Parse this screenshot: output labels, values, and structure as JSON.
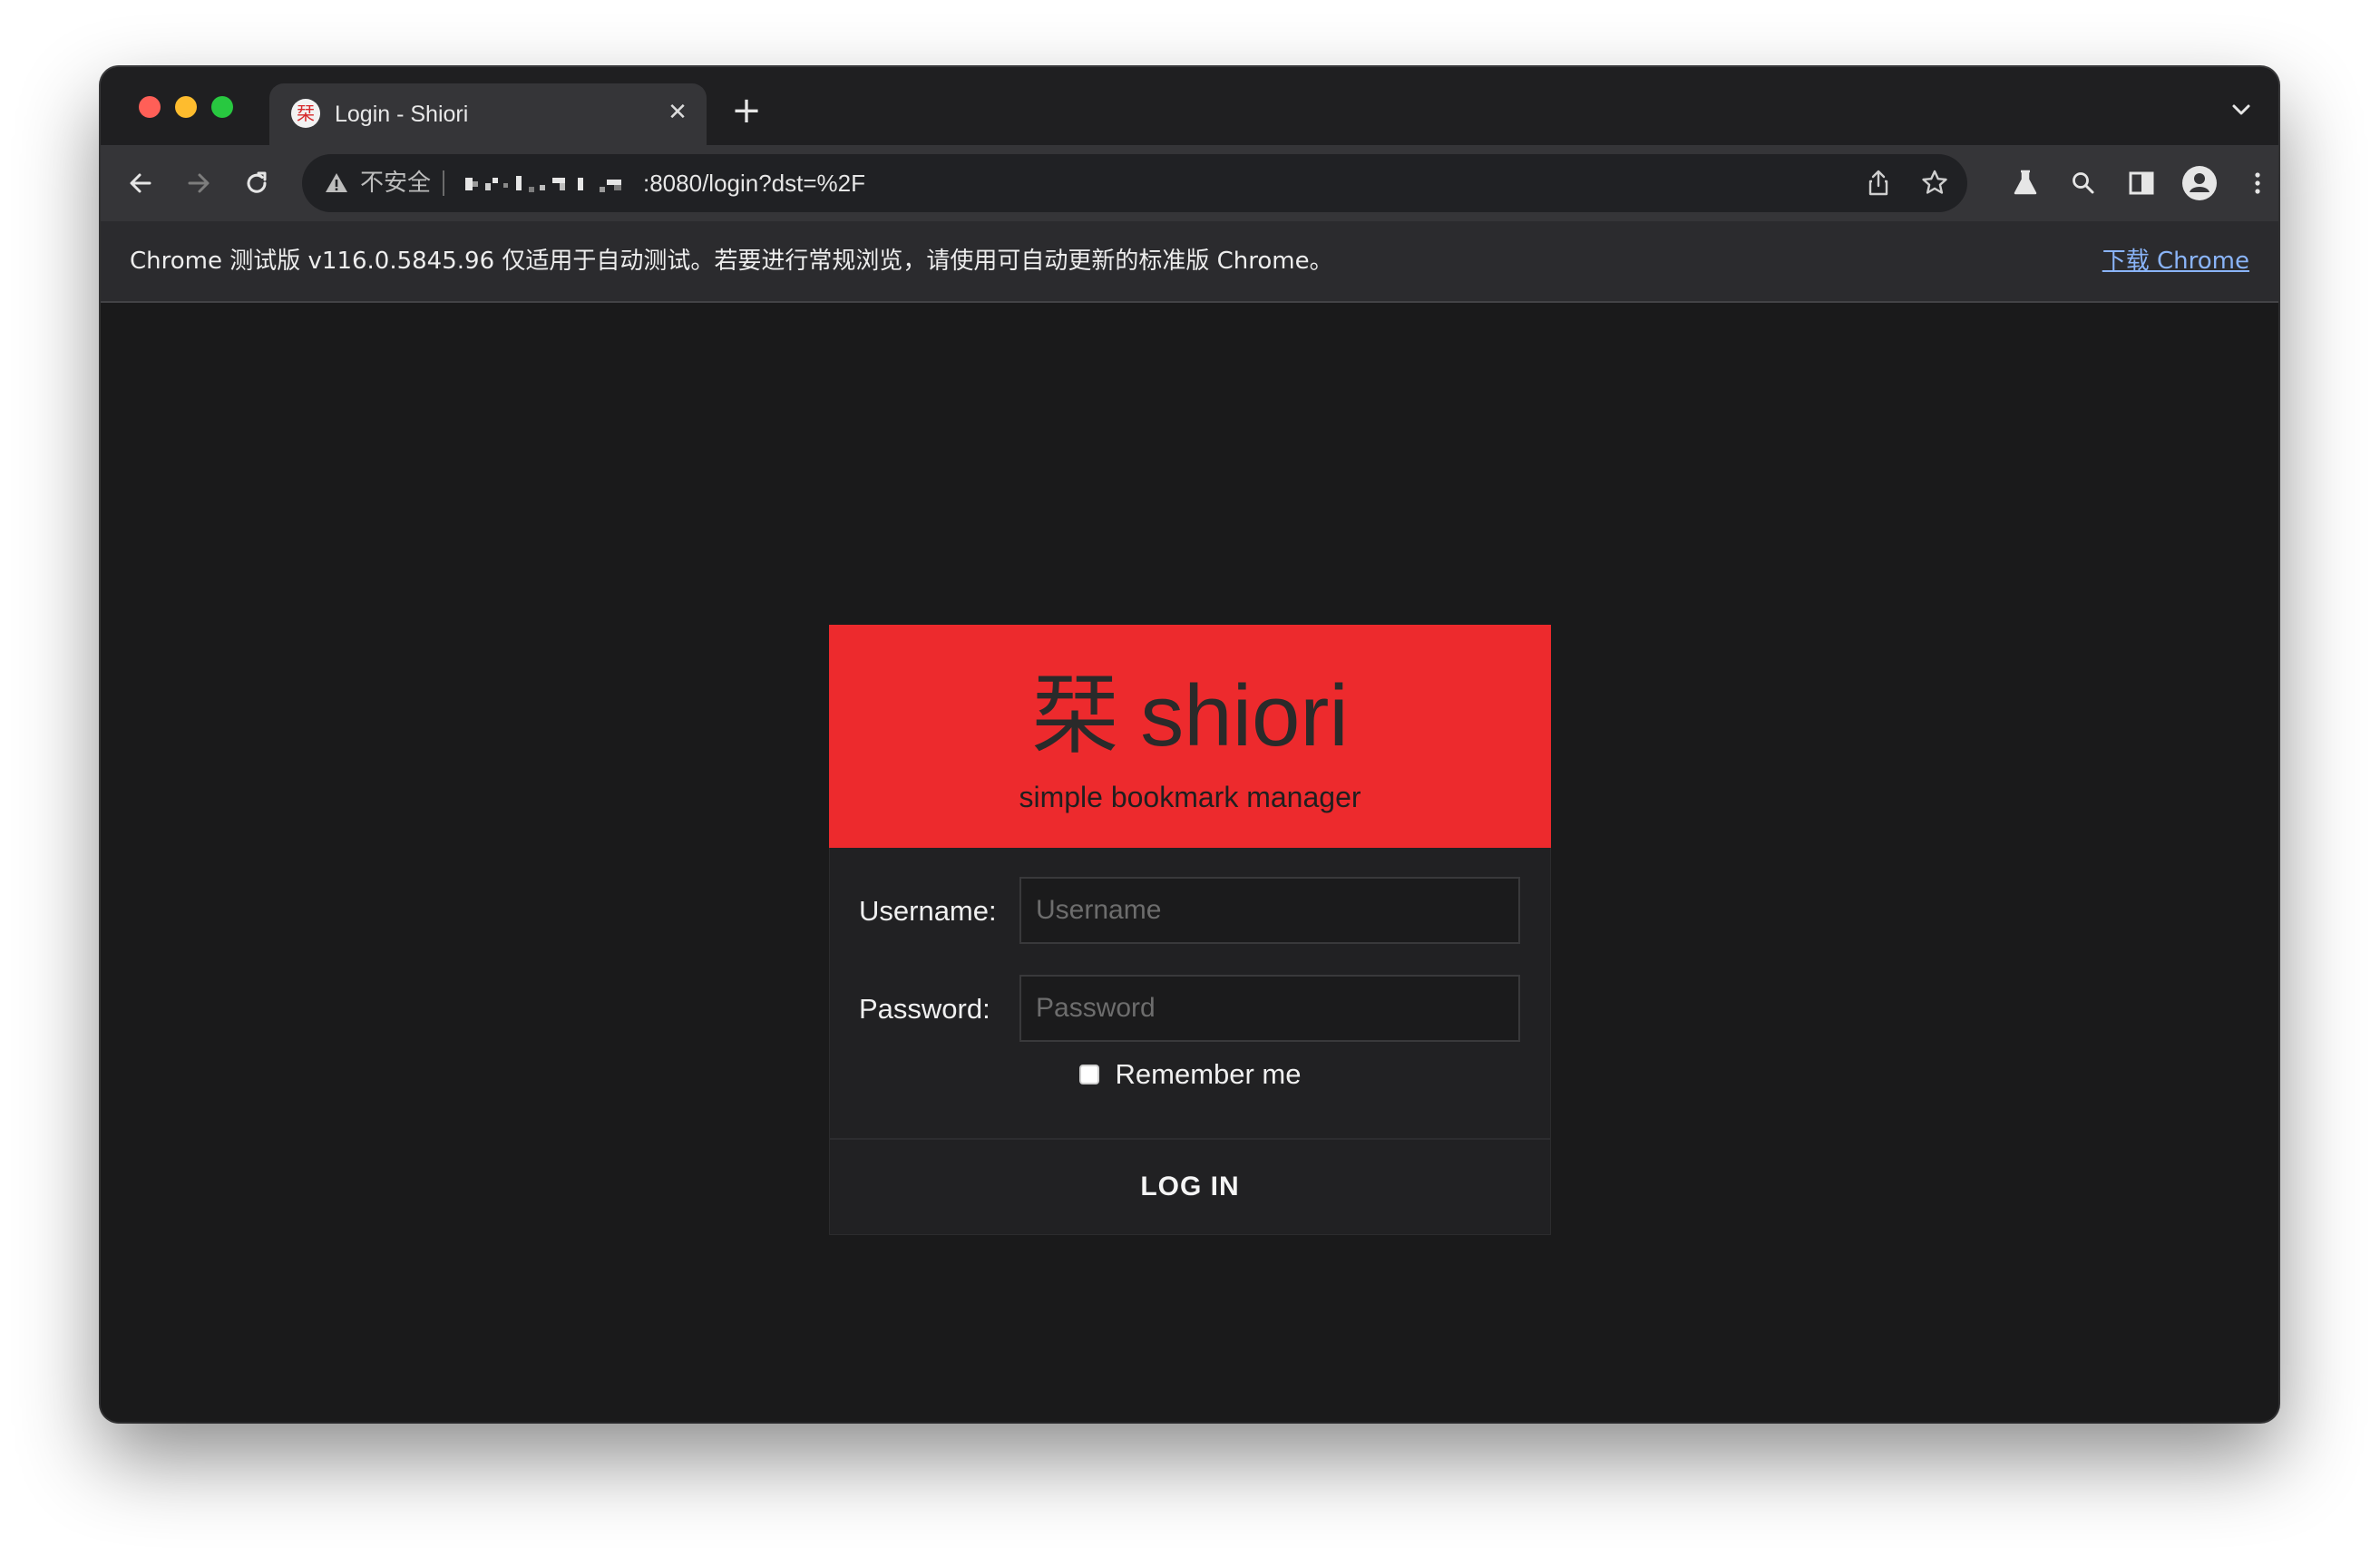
{
  "browser": {
    "tab": {
      "favicon_glyph": "栞",
      "title": "Login - Shiori",
      "close_glyph": "✕"
    },
    "new_tab_glyph": "+",
    "omnibox": {
      "security_label": "不安全",
      "url_visible": ":8080/login?dst=%2F"
    },
    "infobar": {
      "message": "Chrome 测试版 v116.0.5845.96 仅适用于自动测试。若要进行常规浏览，请使用可自动更新的标准版 Chrome。",
      "link": "下载 Chrome"
    },
    "colors": {
      "close": "#ff5f57",
      "minimize": "#febc2e",
      "maximize": "#28c840"
    }
  },
  "login": {
    "brand_glyph": "栞",
    "brand_name": "shiori",
    "tagline": "simple bookmark manager",
    "username_label": "Username:",
    "username_placeholder": "Username",
    "username_value": "",
    "password_label": "Password:",
    "password_placeholder": "Password",
    "password_value": "",
    "remember_label": "Remember me",
    "remember_checked": false,
    "submit_label": "LOG IN",
    "accent_color": "#ed2a2d"
  }
}
